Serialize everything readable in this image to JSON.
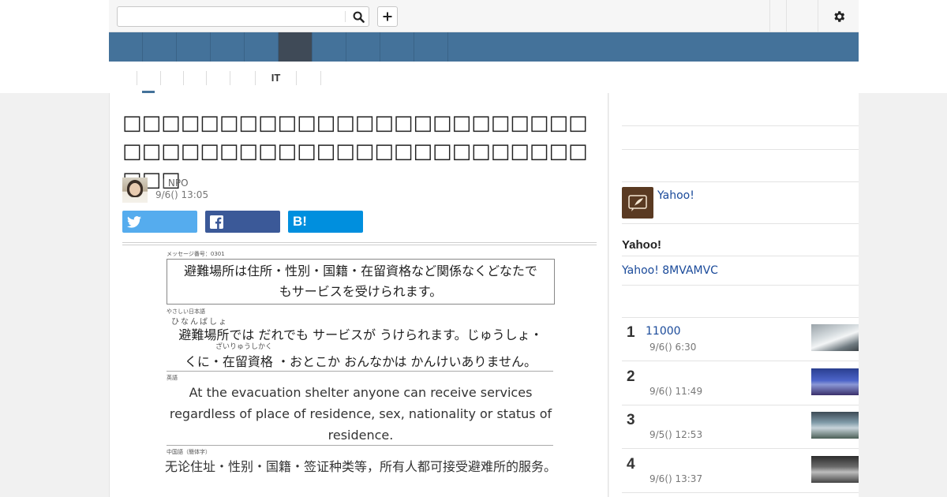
{
  "header": {
    "search": {
      "value": "",
      "placeholder": ""
    },
    "search_button_icon": "search-icon",
    "add_button_icon": "plus-icon",
    "settings_icon": "gear-icon"
  },
  "nav": {
    "tab_count": 10,
    "active_index": 5
  },
  "subnav": {
    "items": [
      "",
      "",
      "",
      "",
      "",
      "IT",
      ""
    ]
  },
  "article": {
    "title": "□□□□□□□□□□□□□□□□□□□□□□□□□□□□□□□□□□□□□□□□□□□□□□□□□□□",
    "author": "",
    "author_org": "| NPO",
    "date": "9/6() 13:05",
    "share": {
      "hatena_label": "B!"
    },
    "figure": {
      "message_no": "メッセージ番号：0301",
      "box_text_1": "避難場所は住所・性別・国籍・在留資格など関係なくどなたで",
      "box_text_2": "もサービスを受けられます。",
      "easy_label": "やさしい日本語",
      "ruby_1": "ひなんばしょ",
      "easy_line_1": "避難場所では だれでも サービスが うけられます。じゅうしょ・",
      "ruby_2": "ざいりゅうしかく",
      "easy_line_2": "くに・在留資格 ・おとこか おんなかは かんけいありません。",
      "english_label": "英語",
      "english_text": "At the evacuation shelter anyone can receive services regardless of place of residence, sex, nationality or status of residence.",
      "chinese_label": "中国語（簡体字）",
      "chinese_text": "无论住址・性别・国籍・签证种类等，所有人都可接受避难所的服务。"
    }
  },
  "sidebar": {
    "author_link": "Yahoo!",
    "section_heading": "Yahoo!",
    "promo_link": "Yahoo! 8MVAMVC",
    "ranking": [
      {
        "rank": "1",
        "title": "11000",
        "date": "9/6() 6:30"
      },
      {
        "rank": "2",
        "title": "",
        "date": "9/6() 11:49"
      },
      {
        "rank": "3",
        "title": "",
        "date": "9/5() 12:53"
      },
      {
        "rank": "4",
        "title": "",
        "date": "9/6() 13:37"
      }
    ]
  }
}
